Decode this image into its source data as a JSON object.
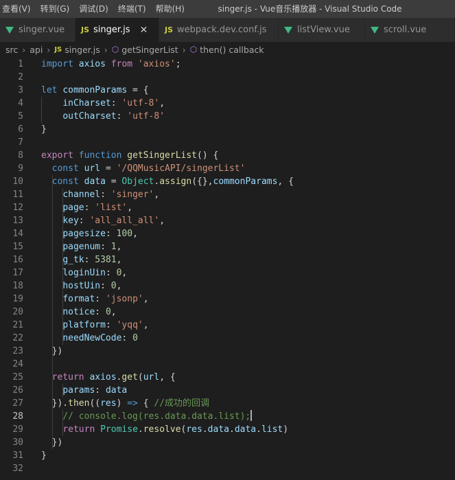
{
  "menu": [
    "查看(V)",
    "转到(G)",
    "调试(D)",
    "终端(T)",
    "帮助(H)"
  ],
  "window_title": "singer.js - Vue音乐播放器 - Visual Studio Code",
  "tabs": [
    {
      "label": "singer.vue",
      "icon": "vue-icon",
      "active": false
    },
    {
      "label": "singer.js",
      "icon": "js-icon",
      "active": true
    },
    {
      "label": "webpack.dev.conf.js",
      "icon": "js-icon",
      "active": false
    },
    {
      "label": "listView.vue",
      "icon": "vue-icon",
      "active": false
    },
    {
      "label": "scroll.vue",
      "icon": "vue-icon",
      "active": false
    }
  ],
  "js_badge": "JS",
  "breadcrumb": [
    "src",
    "api",
    "singer.js",
    "getSingerList",
    "then() callback"
  ],
  "current_line": 28,
  "code_lines": [
    [
      [
        "k",
        "import"
      ],
      [
        "p",
        " "
      ],
      [
        "v",
        "axios"
      ],
      [
        "p",
        " "
      ],
      [
        "kc",
        "from"
      ],
      [
        "p",
        " "
      ],
      [
        "s",
        "'axios'"
      ],
      [
        "p",
        ";"
      ]
    ],
    [],
    [
      [
        "k",
        "let"
      ],
      [
        "p",
        " "
      ],
      [
        "v",
        "commonParams"
      ],
      [
        "p",
        " = {"
      ]
    ],
    [
      [
        "p",
        "    "
      ],
      [
        "v",
        "inCharset"
      ],
      [
        "p",
        ": "
      ],
      [
        "s",
        "'utf-8'"
      ],
      [
        "p",
        ","
      ]
    ],
    [
      [
        "p",
        "    "
      ],
      [
        "v",
        "outCharset"
      ],
      [
        "p",
        ": "
      ],
      [
        "s",
        "'utf-8'"
      ]
    ],
    [
      [
        "p",
        "}"
      ]
    ],
    [],
    [
      [
        "kc",
        "export"
      ],
      [
        "p",
        " "
      ],
      [
        "k",
        "function"
      ],
      [
        "p",
        " "
      ],
      [
        "f",
        "getSingerList"
      ],
      [
        "p",
        "() {"
      ]
    ],
    [
      [
        "p",
        "  "
      ],
      [
        "k",
        "const"
      ],
      [
        "p",
        " "
      ],
      [
        "v",
        "url"
      ],
      [
        "p",
        " = "
      ],
      [
        "s",
        "'/QQMusicAPI/singerList'"
      ]
    ],
    [
      [
        "p",
        "  "
      ],
      [
        "k",
        "const"
      ],
      [
        "p",
        " "
      ],
      [
        "v",
        "data"
      ],
      [
        "p",
        " = "
      ],
      [
        "t",
        "Object"
      ],
      [
        "p",
        "."
      ],
      [
        "f",
        "assign"
      ],
      [
        "p",
        "({},"
      ],
      [
        "v",
        "commonParams"
      ],
      [
        "p",
        ", {"
      ]
    ],
    [
      [
        "p",
        "    "
      ],
      [
        "v",
        "channel"
      ],
      [
        "p",
        ": "
      ],
      [
        "s",
        "'singer'"
      ],
      [
        "p",
        ","
      ]
    ],
    [
      [
        "p",
        "    "
      ],
      [
        "v",
        "page"
      ],
      [
        "p",
        ": "
      ],
      [
        "s",
        "'list'"
      ],
      [
        "p",
        ","
      ]
    ],
    [
      [
        "p",
        "    "
      ],
      [
        "v",
        "key"
      ],
      [
        "p",
        ": "
      ],
      [
        "s",
        "'all_all_all'"
      ],
      [
        "p",
        ","
      ]
    ],
    [
      [
        "p",
        "    "
      ],
      [
        "v",
        "pagesize"
      ],
      [
        "p",
        ": "
      ],
      [
        "n",
        "100"
      ],
      [
        "p",
        ","
      ]
    ],
    [
      [
        "p",
        "    "
      ],
      [
        "v",
        "pagenum"
      ],
      [
        "p",
        ": "
      ],
      [
        "n",
        "1"
      ],
      [
        "p",
        ","
      ]
    ],
    [
      [
        "p",
        "    "
      ],
      [
        "v",
        "g_tk"
      ],
      [
        "p",
        ": "
      ],
      [
        "n",
        "5381"
      ],
      [
        "p",
        ","
      ]
    ],
    [
      [
        "p",
        "    "
      ],
      [
        "v",
        "loginUin"
      ],
      [
        "p",
        ": "
      ],
      [
        "n",
        "0"
      ],
      [
        "p",
        ","
      ]
    ],
    [
      [
        "p",
        "    "
      ],
      [
        "v",
        "hostUin"
      ],
      [
        "p",
        ": "
      ],
      [
        "n",
        "0"
      ],
      [
        "p",
        ","
      ]
    ],
    [
      [
        "p",
        "    "
      ],
      [
        "v",
        "format"
      ],
      [
        "p",
        ": "
      ],
      [
        "s",
        "'jsonp'"
      ],
      [
        "p",
        ","
      ]
    ],
    [
      [
        "p",
        "    "
      ],
      [
        "v",
        "notice"
      ],
      [
        "p",
        ": "
      ],
      [
        "n",
        "0"
      ],
      [
        "p",
        ","
      ]
    ],
    [
      [
        "p",
        "    "
      ],
      [
        "v",
        "platform"
      ],
      [
        "p",
        ": "
      ],
      [
        "s",
        "'yqq'"
      ],
      [
        "p",
        ","
      ]
    ],
    [
      [
        "p",
        "    "
      ],
      [
        "v",
        "needNewCode"
      ],
      [
        "p",
        ": "
      ],
      [
        "n",
        "0"
      ]
    ],
    [
      [
        "p",
        "  })"
      ]
    ],
    [],
    [
      [
        "p",
        "  "
      ],
      [
        "kc",
        "return"
      ],
      [
        "p",
        " "
      ],
      [
        "v",
        "axios"
      ],
      [
        "p",
        "."
      ],
      [
        "f",
        "get"
      ],
      [
        "p",
        "("
      ],
      [
        "v",
        "url"
      ],
      [
        "p",
        ", {"
      ]
    ],
    [
      [
        "p",
        "    "
      ],
      [
        "v",
        "params"
      ],
      [
        "p",
        ": "
      ],
      [
        "v",
        "data"
      ]
    ],
    [
      [
        "p",
        "  })."
      ],
      [
        "f",
        "then"
      ],
      [
        "p",
        "(("
      ],
      [
        "v",
        "res"
      ],
      [
        "p",
        ") "
      ],
      [
        "k",
        "=>"
      ],
      [
        "p",
        " { "
      ],
      [
        "c",
        "//成功的回调"
      ]
    ],
    [
      [
        "p",
        "    "
      ],
      [
        "c",
        "// console.log(res.data.data.list);"
      ]
    ],
    [
      [
        "p",
        "    "
      ],
      [
        "kc",
        "return"
      ],
      [
        "p",
        " "
      ],
      [
        "t",
        "Promise"
      ],
      [
        "p",
        "."
      ],
      [
        "f",
        "resolve"
      ],
      [
        "p",
        "("
      ],
      [
        "v",
        "res"
      ],
      [
        "p",
        "."
      ],
      [
        "v",
        "data"
      ],
      [
        "p",
        "."
      ],
      [
        "v",
        "data"
      ],
      [
        "p",
        "."
      ],
      [
        "v",
        "list"
      ],
      [
        "p",
        ")"
      ]
    ],
    [
      [
        "p",
        "  })"
      ]
    ],
    [
      [
        "p",
        "}"
      ]
    ],
    []
  ]
}
